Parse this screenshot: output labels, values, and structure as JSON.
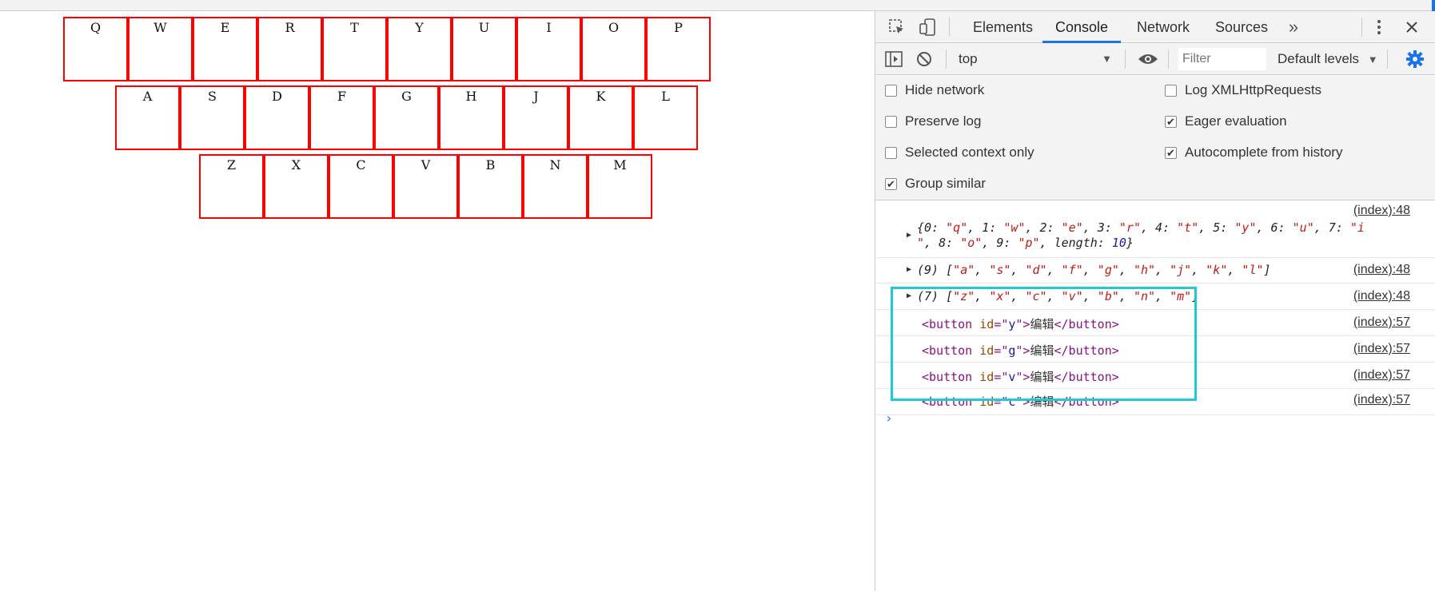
{
  "keyboard": {
    "row1": [
      "Q",
      "W",
      "E",
      "R",
      "T",
      "Y",
      "U",
      "I",
      "O",
      "P"
    ],
    "row2": [
      "A",
      "S",
      "D",
      "F",
      "G",
      "H",
      "J",
      "K",
      "L"
    ],
    "row3": [
      "Z",
      "X",
      "C",
      "V",
      "B",
      "N",
      "M"
    ]
  },
  "devtools": {
    "tabs": [
      "Elements",
      "Console",
      "Network",
      "Sources"
    ],
    "active_tab": "Console",
    "more_tabs": "»",
    "toolbar": {
      "context": "top",
      "filter_placeholder": "Filter",
      "levels": "Default levels"
    },
    "settings": [
      {
        "label": "Hide network",
        "checked": false
      },
      {
        "label": "Log XMLHttpRequests",
        "checked": false
      },
      {
        "label": "Preserve log",
        "checked": false
      },
      {
        "label": "Eager evaluation",
        "checked": true
      },
      {
        "label": "Selected context only",
        "checked": false
      },
      {
        "label": "Autocomplete from history",
        "checked": true
      },
      {
        "label": "Group similar",
        "checked": true
      }
    ],
    "console": {
      "messages": [
        {
          "source": "(index):48"
        },
        {
          "source": "(index):48",
          "count": "(9)",
          "values": [
            "a",
            "s",
            "d",
            "f",
            "g",
            "h",
            "j",
            "k",
            "l"
          ]
        },
        {
          "source": "(index):48",
          "count": "(7)",
          "values": [
            "z",
            "x",
            "c",
            "v",
            "b",
            "n",
            "m"
          ]
        },
        {
          "source": "(index):57",
          "id": "y",
          "text": "编辑"
        },
        {
          "source": "(index):57",
          "id": "g",
          "text": "编辑"
        },
        {
          "source": "(index):57",
          "id": "v",
          "text": "编辑"
        },
        {
          "source": "(index):57",
          "id": "c",
          "text": "编辑"
        }
      ],
      "object_line1": [
        "q",
        "w",
        "e",
        "r",
        "t",
        "y",
        "u",
        "i"
      ],
      "object_line2": [
        "o",
        "p"
      ],
      "object_length": "10",
      "prompt": "›",
      "highlight_color": "#21c9d8"
    }
  },
  "colors": {
    "key_border": "#ff0000",
    "accent": "#1a73e8"
  }
}
